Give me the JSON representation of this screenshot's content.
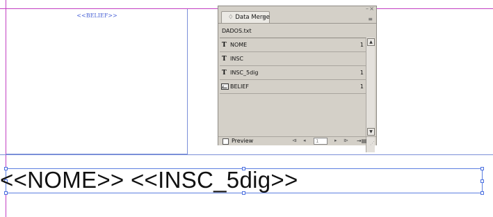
{
  "layout_frames": {
    "image_placeholder": "<<BELIEF>>",
    "text_placeholder": "<<NOME>> <<INSC_5dig>>"
  },
  "panel": {
    "tab_label": "♢ Data Merge",
    "tab_close": "×",
    "collapse_symbol": "–",
    "close_symbol": "×",
    "menu_symbol": "≡",
    "source_file": "DADOS.txt",
    "fields": [
      {
        "type_icon": "T",
        "label": "NOME",
        "count": "1"
      },
      {
        "type_icon": "T",
        "label": "INSC",
        "count": ""
      },
      {
        "type_icon": "T",
        "label": "INSC_5dig",
        "count": "1"
      },
      {
        "type_icon": "image",
        "label": "BELIEF",
        "count": "1"
      }
    ],
    "preview_label": "Preview",
    "record_value": "1",
    "nav_first": "⧏",
    "nav_prev": "◂",
    "nav_next": "▸",
    "nav_last": "⧐",
    "create_merged_symbol": "→▤",
    "scroll_up": "▲",
    "scroll_down": "▼"
  }
}
